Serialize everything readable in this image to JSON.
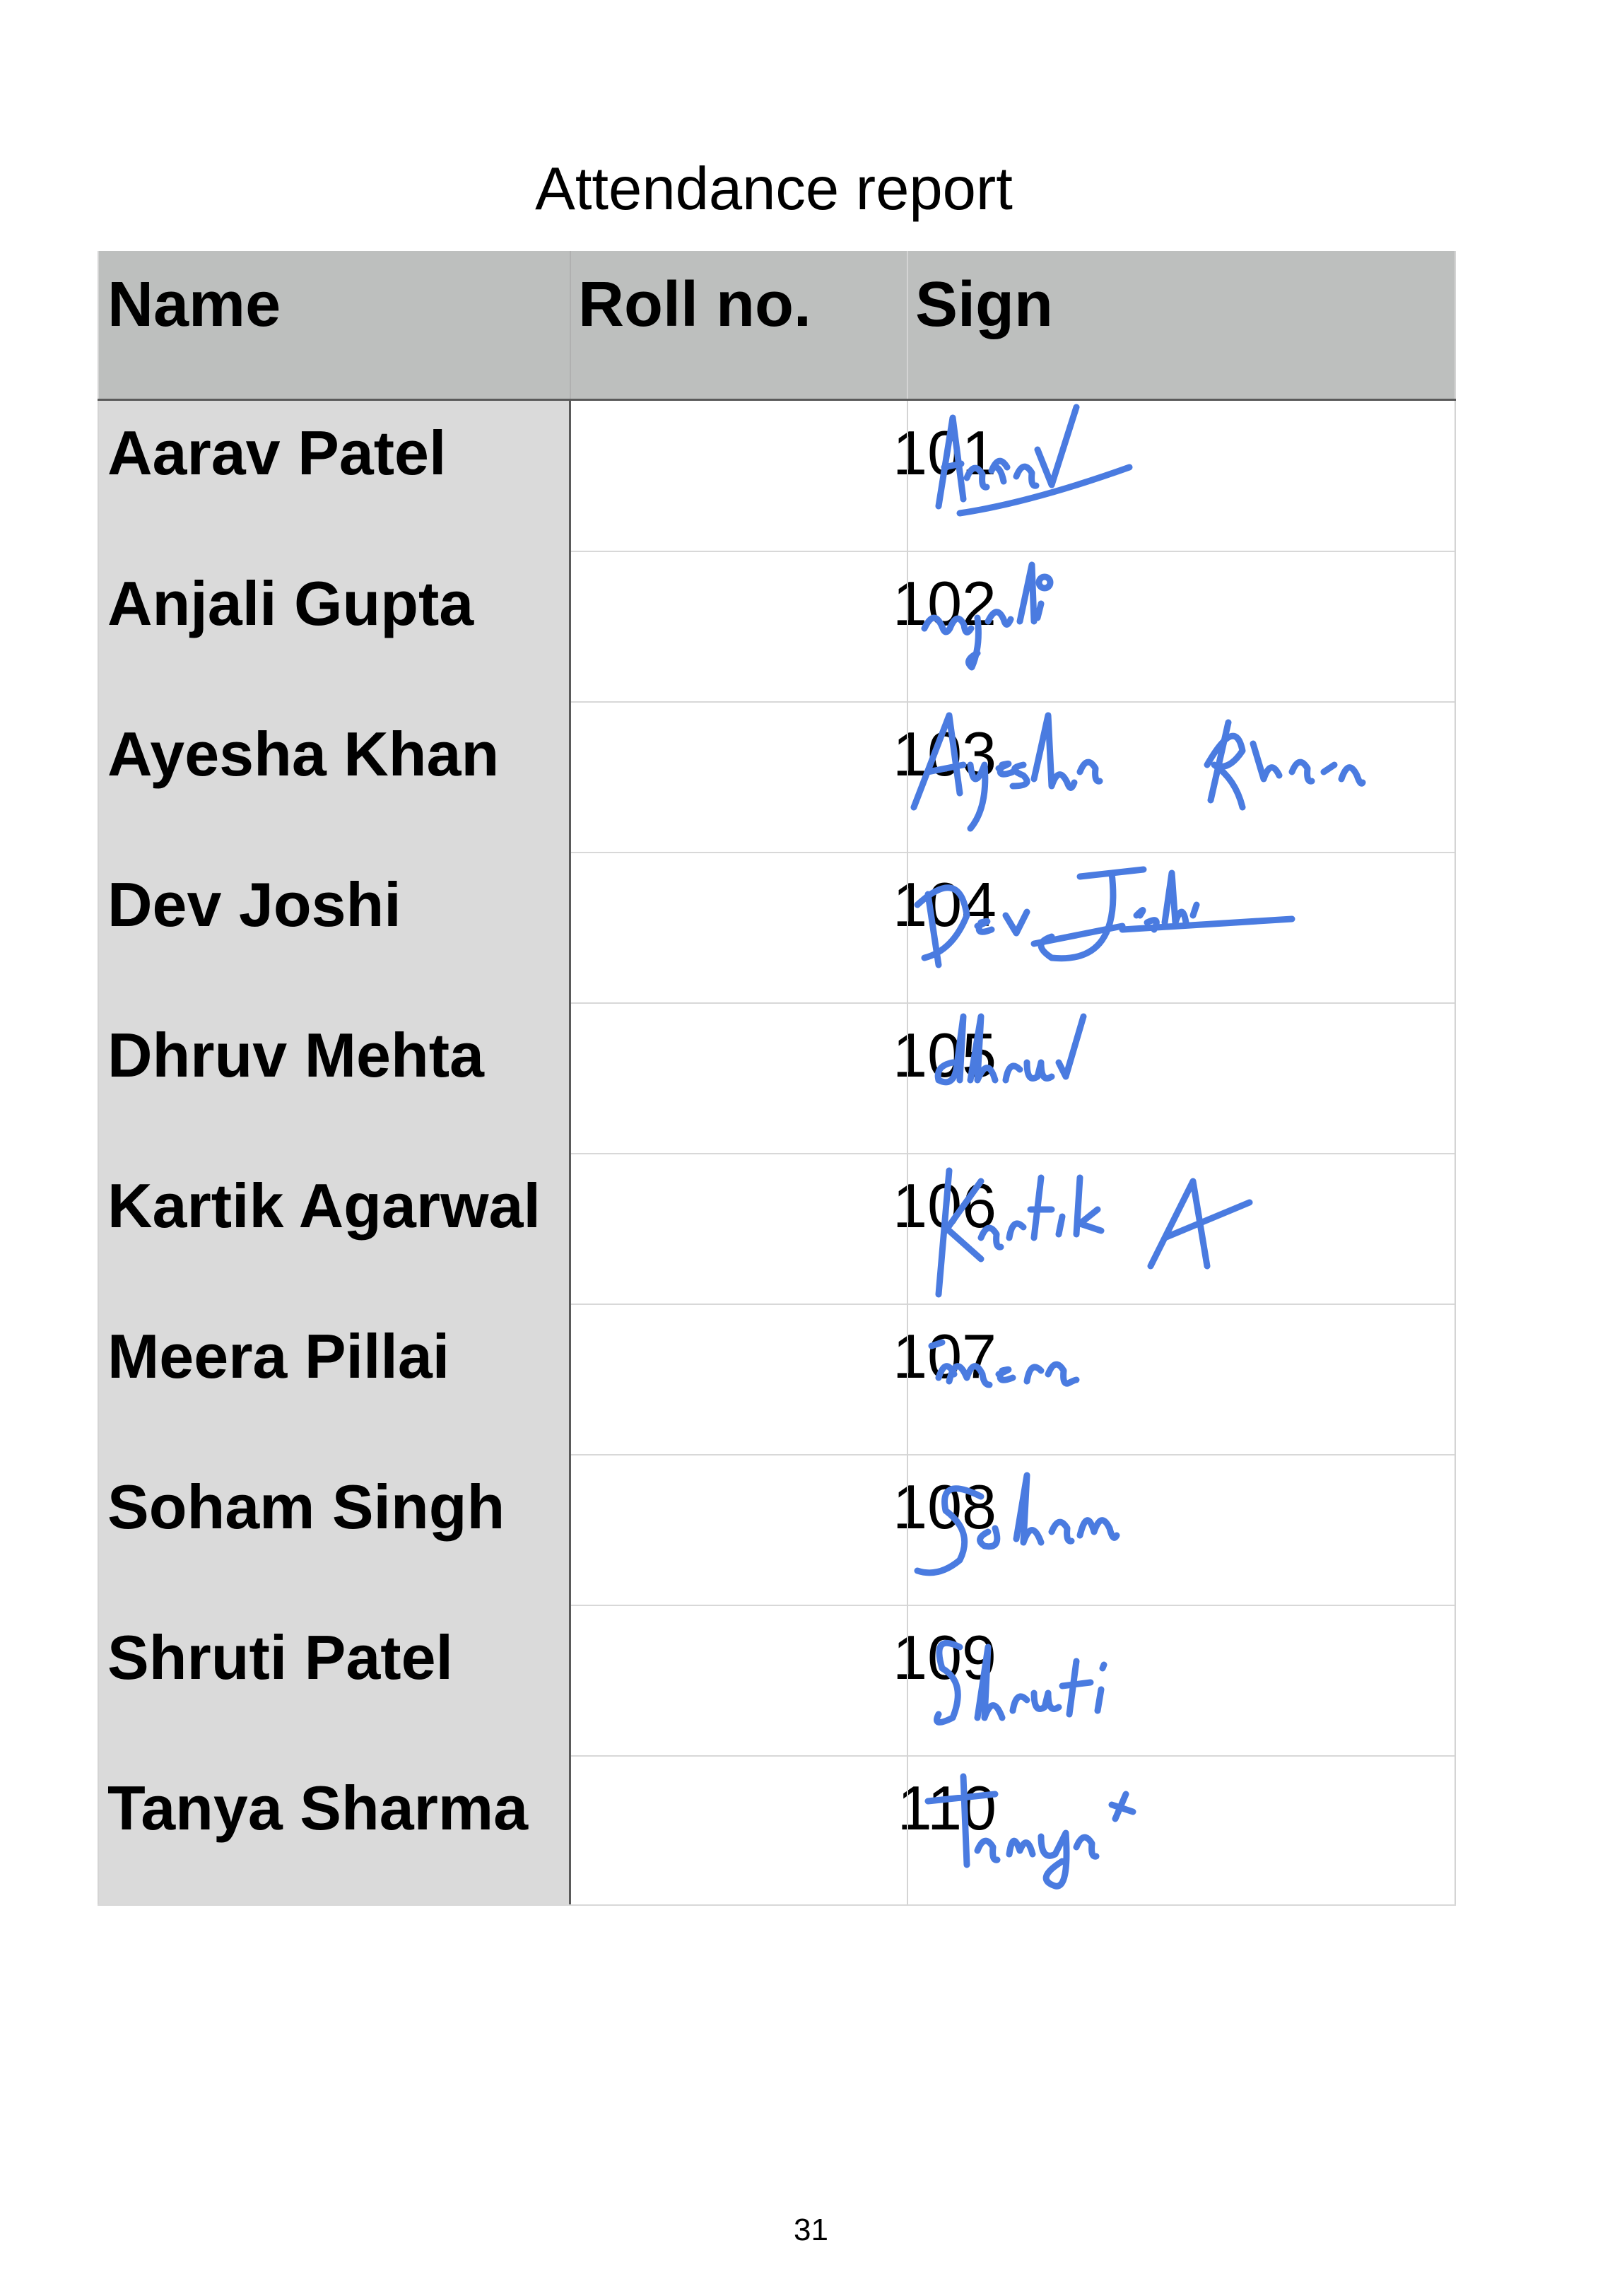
{
  "document": {
    "title": "Attendance report",
    "page_number": "31"
  },
  "table": {
    "headers": {
      "name": "Name",
      "roll": "Roll no.",
      "sign": "Sign"
    },
    "rows": [
      {
        "name": "Aarav Patel",
        "roll": "101",
        "signature": "Aarav"
      },
      {
        "name": "Anjali Gupta",
        "roll": "102",
        "signature": "anjali"
      },
      {
        "name": "Ayesha Khan",
        "roll": "103",
        "signature": "Ayesha Khan"
      },
      {
        "name": "Dev Joshi",
        "roll": "104",
        "signature": "Dev Joshi"
      },
      {
        "name": "Dhruv Mehta",
        "roll": "105",
        "signature": "dhruv"
      },
      {
        "name": "Kartik Agarwal",
        "roll": "106",
        "signature": "Kartik A"
      },
      {
        "name": "Meera Pillai",
        "roll": "107",
        "signature": "meera"
      },
      {
        "name": "Soham Singh",
        "roll": "108",
        "signature": "Soham"
      },
      {
        "name": "Shruti Patel",
        "roll": "109",
        "signature": "Shruti"
      },
      {
        "name": "Tanya Sharma",
        "roll": "110",
        "signature": "Tanya"
      }
    ]
  },
  "colors": {
    "header_bg": "#bdbfbe",
    "name_column_bg": "#dadada",
    "signature_ink": "#4a7be0"
  }
}
